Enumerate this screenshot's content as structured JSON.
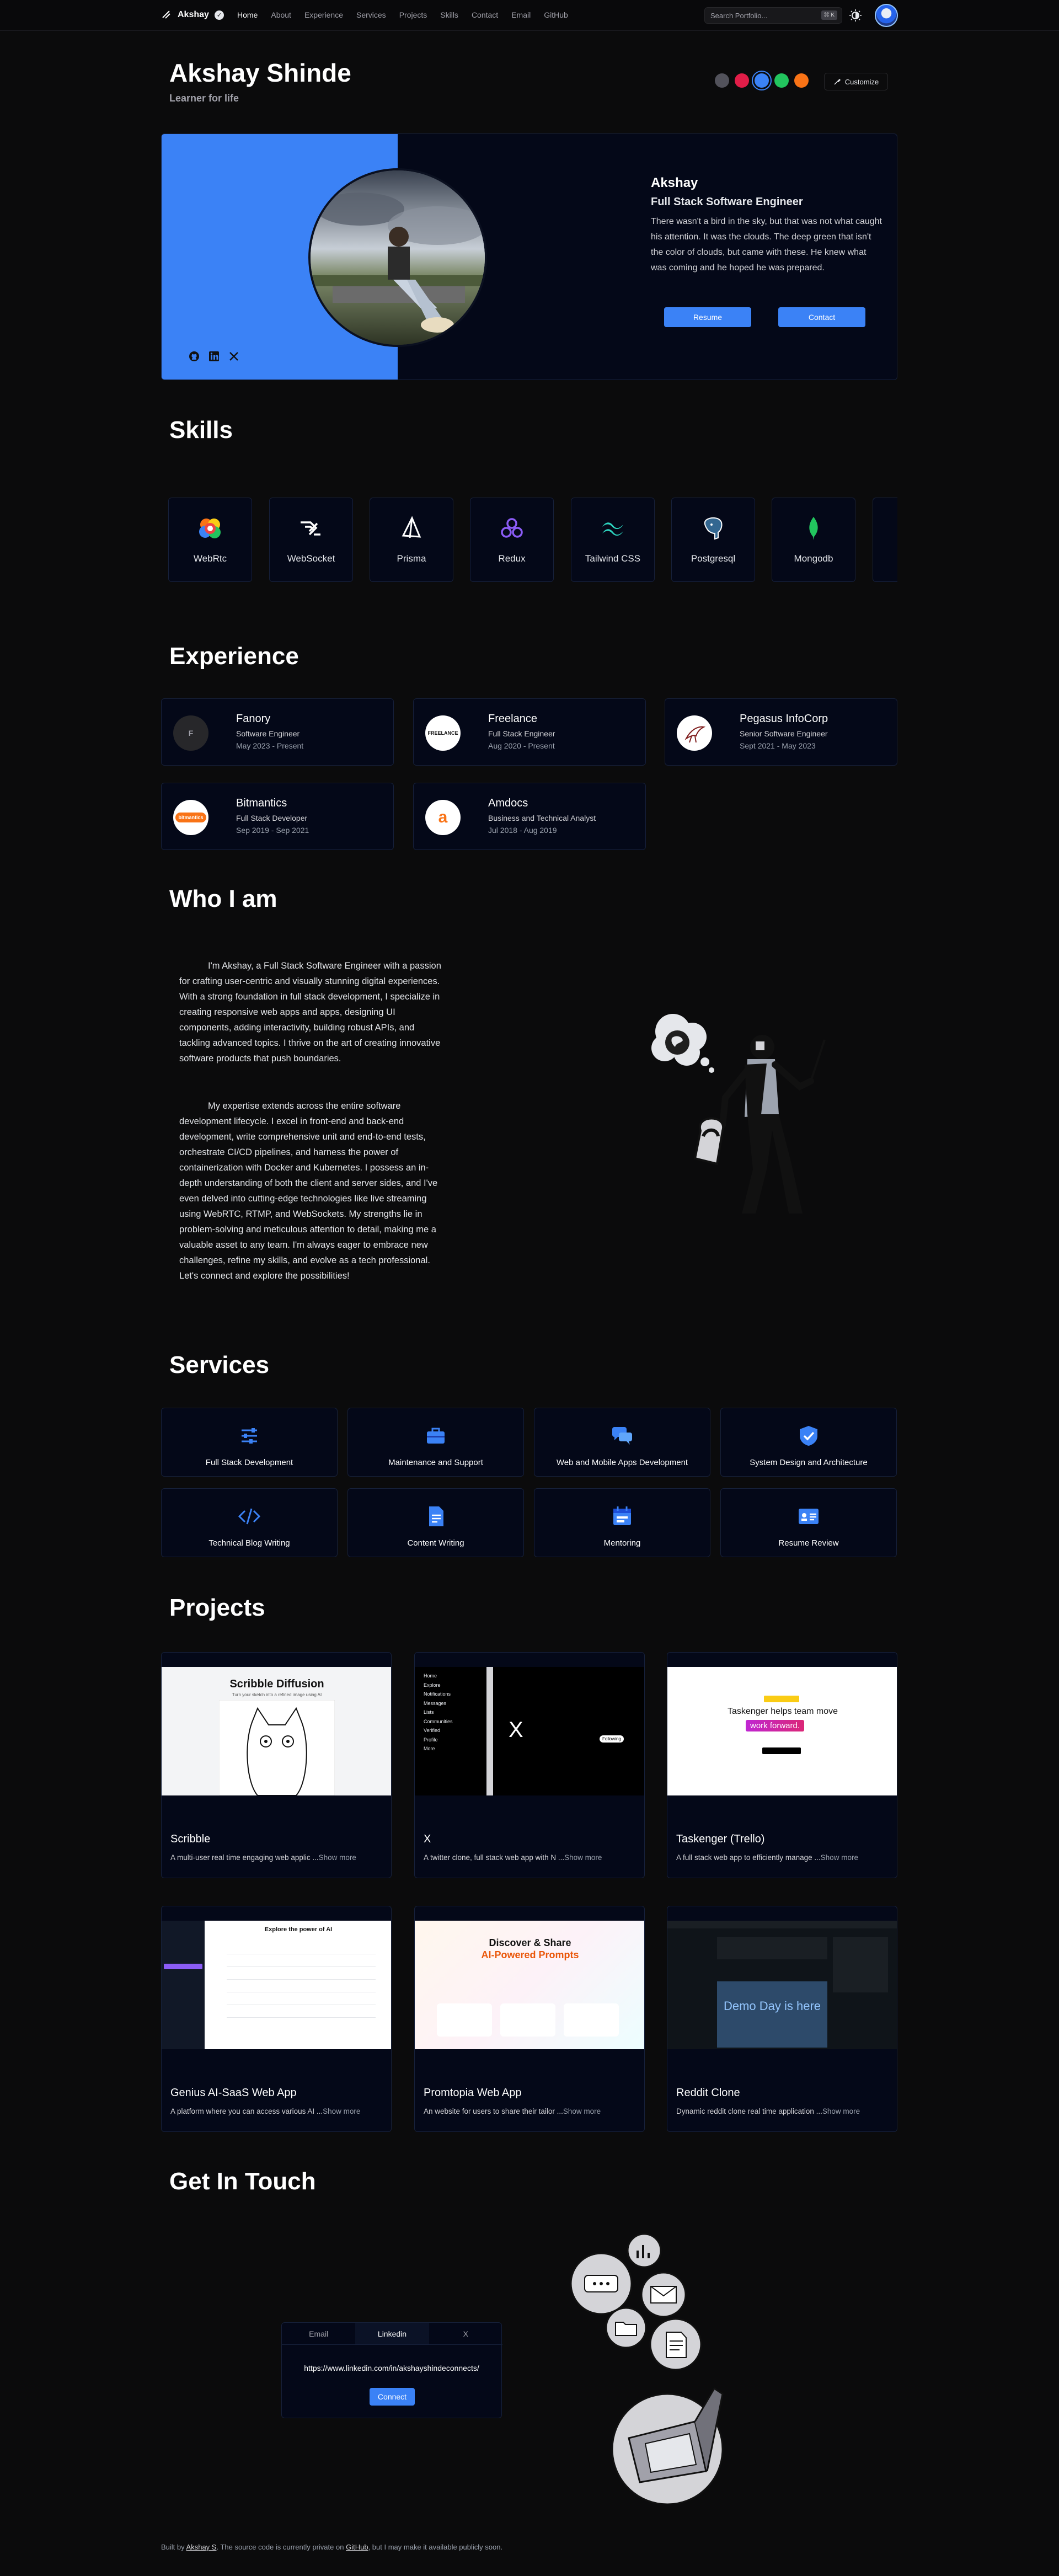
{
  "nav": {
    "brand": "Akshay",
    "links": [
      "Home",
      "About",
      "Experience",
      "Services",
      "Projects",
      "Skills",
      "Contact",
      "Email",
      "GitHub"
    ],
    "search_placeholder": "Search Portfolio...",
    "search_kbd": "⌘ K"
  },
  "hero": {
    "title": "Akshay Shinde",
    "subtitle": "Learner for life",
    "swatch_colors": [
      "#52525b",
      "#e11d48",
      "#3b82f6",
      "#22c55e",
      "#f97316"
    ],
    "customize_label": "Customize",
    "name": "Akshay",
    "role": "Full Stack Software Engineer",
    "bio": "There wasn't a bird in the sky, but that was not what caught his attention. It was the clouds. The deep green that isn't the color of clouds, but came with these. He knew what was coming and he hoped he was prepared.",
    "resume_label": "Resume",
    "contact_label": "Contact",
    "accent": "#3b82f6"
  },
  "skills": {
    "title": "Skills",
    "items": [
      {
        "label": "WebRtc",
        "icon": "webrtc-icon"
      },
      {
        "label": "WebSocket",
        "icon": "websocket-icon"
      },
      {
        "label": "Prisma",
        "icon": "prisma-icon"
      },
      {
        "label": "Redux",
        "icon": "redux-icon"
      },
      {
        "label": "Tailwind CSS",
        "icon": "tailwind-icon"
      },
      {
        "label": "Postgresql",
        "icon": "postgresql-icon"
      },
      {
        "label": "Mongodb",
        "icon": "mongodb-icon"
      }
    ]
  },
  "experience": {
    "title": "Experience",
    "items": [
      {
        "company": "Fanory",
        "role": "Software Engineer",
        "dates": "May 2023 - Present",
        "logo_text": "F"
      },
      {
        "company": "Freelance",
        "role": "Full Stack Engineer",
        "dates": "Aug 2020 - Present",
        "logo_text": "FREELANCE"
      },
      {
        "company": "Pegasus InfoCorp",
        "role": "Senior Software Engineer",
        "dates": "Sept 2021 - May 2023",
        "logo_text": ""
      },
      {
        "company": "Bitmantics",
        "role": "Full Stack Developer",
        "dates": "Sep 2019 - Sep 2021",
        "logo_text": "bitmantics"
      },
      {
        "company": "Amdocs",
        "role": "Business and Technical Analyst",
        "dates": "Jul 2018 - Aug 2019",
        "logo_text": "a"
      }
    ]
  },
  "about": {
    "title": "Who I am",
    "p1": "I'm Akshay, a Full Stack Software Engineer with a passion for crafting user-centric and visually stunning digital experiences. With a strong foundation in full stack development, I specialize in creating responsive web apps and apps, designing UI components, adding interactivity, building robust APIs, and tackling advanced topics. I thrive on the art of creating innovative software products that push boundaries.",
    "p2": "My expertise extends across the entire software development lifecycle. I excel in front-end and back-end development, write comprehensive unit and end-to-end tests, orchestrate CI/CD pipelines, and harness the power of containerization with Docker and Kubernetes. I possess an in-depth understanding of both the client and server sides, and I've even delved into cutting-edge technologies like live streaming using WebRTC, RTMP, and WebSockets. My strengths lie in problem-solving and meticulous attention to detail, making me a valuable asset to any team. I'm always eager to embrace new challenges, refine my skills, and evolve as a tech professional. Let's connect and explore the possibilities!"
  },
  "services": {
    "title": "Services",
    "items": [
      {
        "label": "Full Stack Development",
        "icon": "sliders-icon"
      },
      {
        "label": "Maintenance and Support",
        "icon": "toolbox-icon"
      },
      {
        "label": "Web and Mobile Apps Development",
        "icon": "chat-bubbles-icon"
      },
      {
        "label": "System Design and Architecture",
        "icon": "shield-check-icon"
      },
      {
        "label": "Technical Blog Writing",
        "icon": "code-icon"
      },
      {
        "label": "Content Writing",
        "icon": "document-icon"
      },
      {
        "label": "Mentoring",
        "icon": "calendar-icon"
      },
      {
        "label": "Resume Review",
        "icon": "id-card-icon"
      }
    ]
  },
  "projects": {
    "title": "Projects",
    "show_more": "Show more",
    "items": [
      {
        "title": "Scribble",
        "desc": "A multi-user real time engaging web applic",
        "shot_title": "Scribble Diffusion",
        "shot_sub": "Turn your sketch into a refined image using AI"
      },
      {
        "title": "X",
        "desc": "A twitter clone, full stack web app with N",
        "shot_title": "X",
        "menu": [
          "Home",
          "Explore",
          "Notifications",
          "Messages",
          "Lists",
          "Communities",
          "Verified",
          "Profile",
          "More"
        ],
        "shot_handle": "Following"
      },
      {
        "title": "Taskenger (Trello)",
        "desc": "A full stack web app to efficiently manage",
        "shot_title": "Taskenger helps team move",
        "shot_highlight": "work forward."
      },
      {
        "title": "Genius AI-SaaS Web App",
        "desc": "A platform where you can access various AI",
        "shot_title": "Explore the power of AI"
      },
      {
        "title": "Promtopia Web App",
        "desc": "An website for users to share their tailor",
        "shot_title": "Discover & Share",
        "shot_highlight": "AI-Powered Prompts"
      },
      {
        "title": "Reddit Clone",
        "desc": "Dynamic reddit clone real time application",
        "shot_title": "Demo Day is here"
      }
    ]
  },
  "contact": {
    "title": "Get In Touch",
    "tabs": [
      "Email",
      "Linkedin",
      "X"
    ],
    "url": "https://www.linkedin.com/in/akshayshindeconnects/",
    "button": "Connect"
  },
  "footer": {
    "prefix": "Built by",
    "author": "Akshay S",
    "middle": ". The source code is currently private on",
    "github": "GitHub",
    "suffix": ", but I may make it available publicly soon."
  }
}
